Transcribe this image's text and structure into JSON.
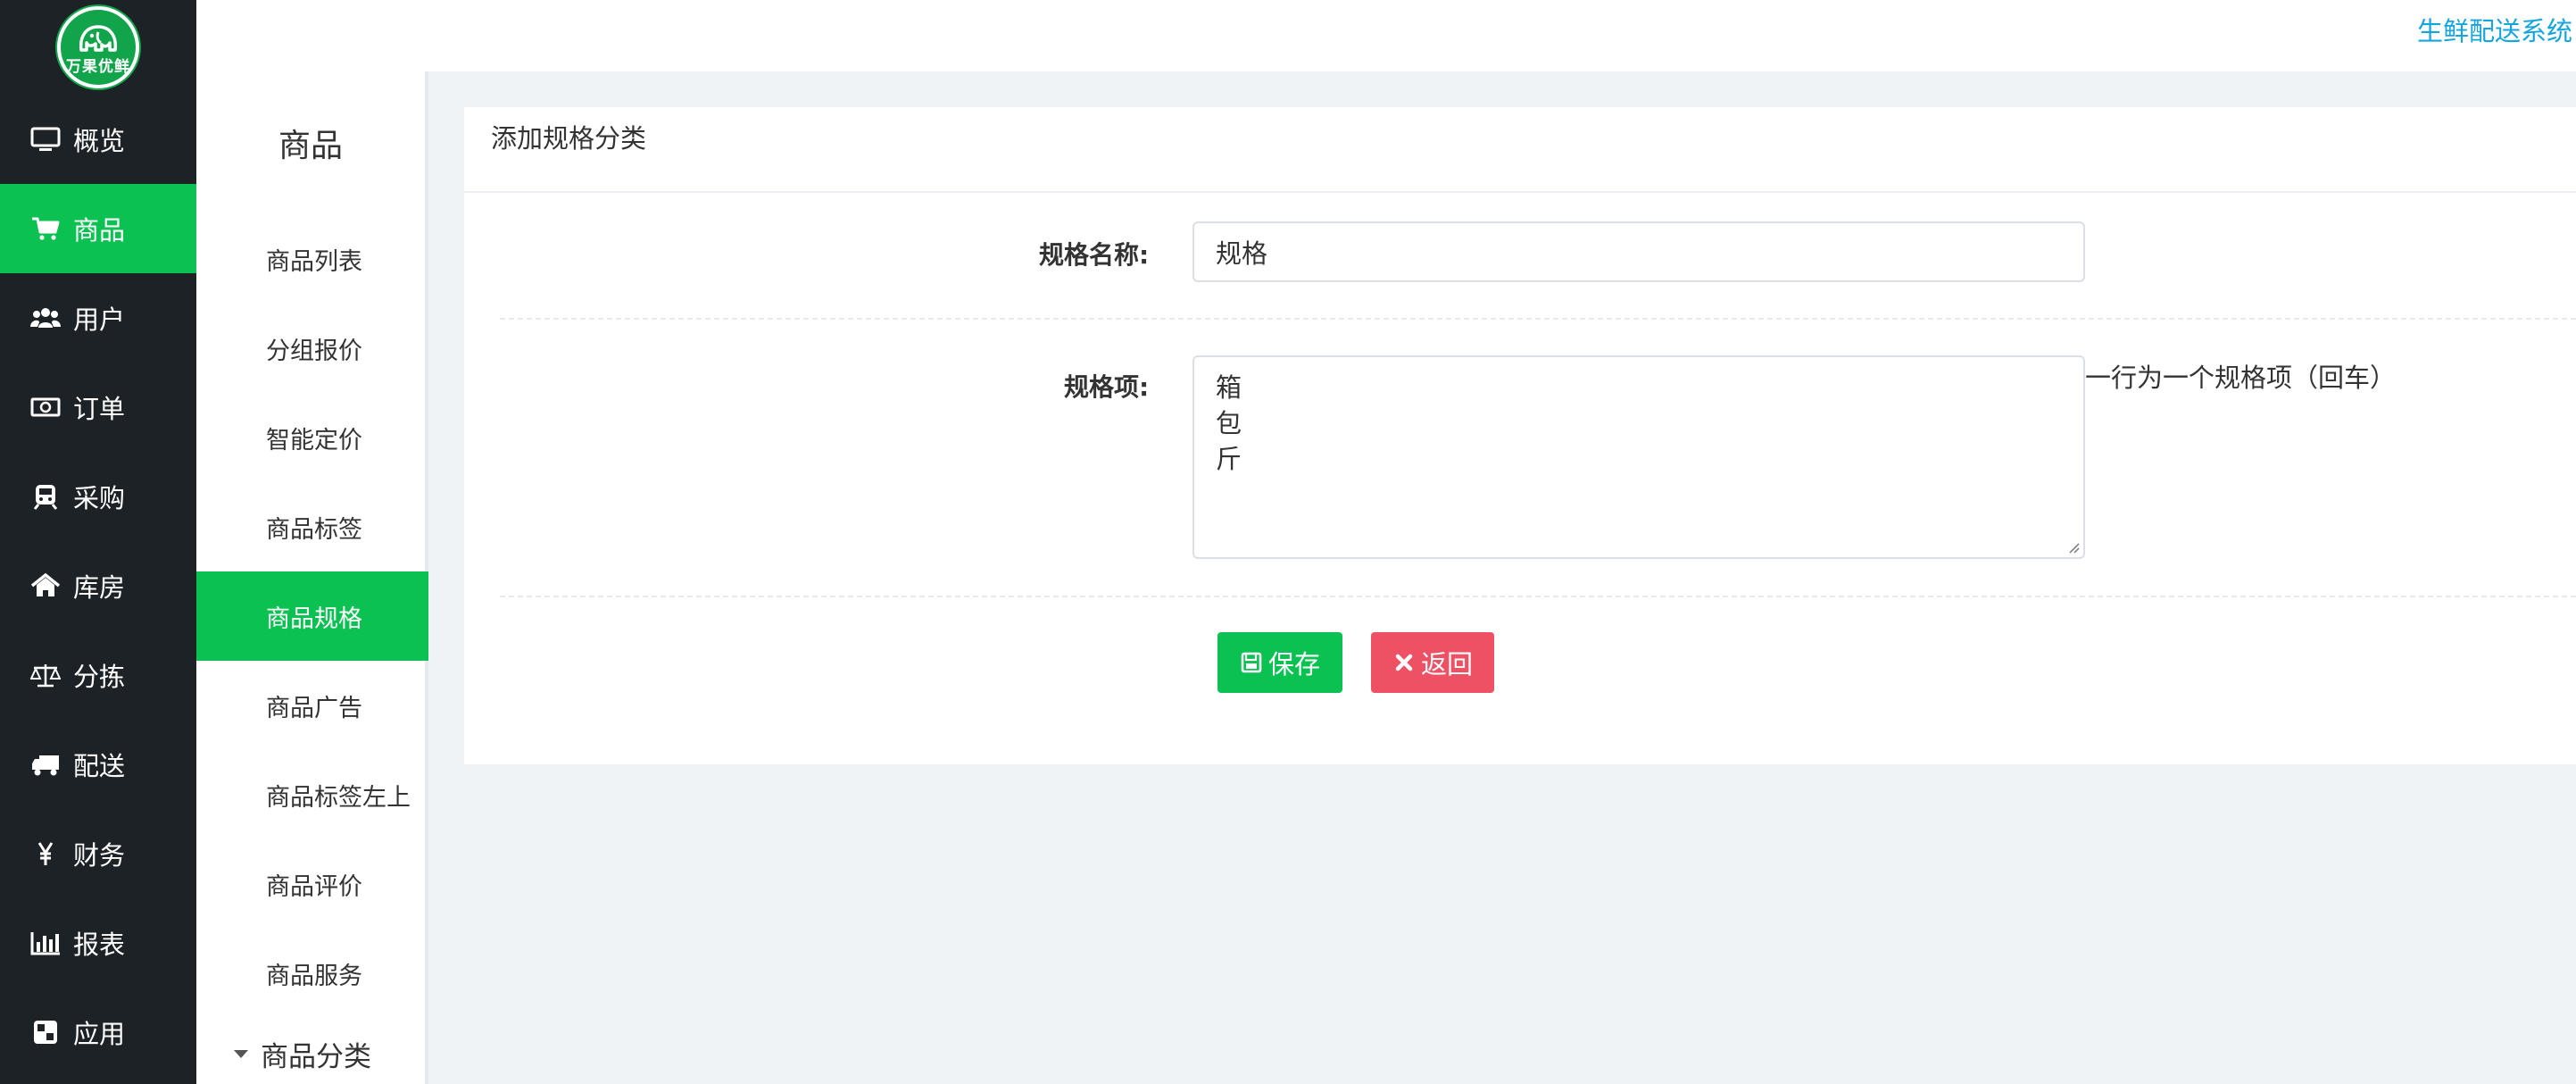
{
  "app": {
    "logo_text": "万果优鲜",
    "system_title": "生鲜配送系统"
  },
  "sidebar": {
    "items": [
      {
        "label": "概览",
        "icon": "monitor-icon",
        "active": false
      },
      {
        "label": "商品",
        "icon": "cart-icon",
        "active": true
      },
      {
        "label": "用户",
        "icon": "users-icon",
        "active": false
      },
      {
        "label": "订单",
        "icon": "money-icon",
        "active": false
      },
      {
        "label": "采购",
        "icon": "train-icon",
        "active": false
      },
      {
        "label": "库房",
        "icon": "home-icon",
        "active": false
      },
      {
        "label": "分拣",
        "icon": "balance-scale-icon",
        "active": false
      },
      {
        "label": "配送",
        "icon": "truck-icon",
        "active": false
      },
      {
        "label": "财务",
        "icon": "yen-icon",
        "active": false
      },
      {
        "label": "报表",
        "icon": "bar-chart-icon",
        "active": false
      },
      {
        "label": "应用",
        "icon": "apps-icon",
        "active": false
      }
    ]
  },
  "submenu": {
    "title": "商品",
    "items": [
      {
        "label": "商品列表",
        "active": false
      },
      {
        "label": "分组报价",
        "active": false
      },
      {
        "label": "智能定价",
        "active": false
      },
      {
        "label": "商品标签",
        "active": false
      },
      {
        "label": "商品规格",
        "active": true
      },
      {
        "label": "商品广告",
        "active": false
      },
      {
        "label": "商品标签左上",
        "active": false
      },
      {
        "label": "商品评价",
        "active": false
      },
      {
        "label": "商品服务",
        "active": false
      }
    ],
    "group_label": "商品分类"
  },
  "panel": {
    "title": "添加规格分类",
    "spec_name_label": "规格名称:",
    "spec_name_value": "规格",
    "spec_items_label": "规格项:",
    "spec_items_lines": [
      "箱",
      "包",
      "斤"
    ],
    "spec_items_hint": "一行为一个规格项（回车）",
    "save_label": "保存",
    "back_label": "返回"
  },
  "colors": {
    "sidebar_bg": "#1c2226",
    "accent_green": "#0bc152",
    "danger_red": "#ee5064",
    "title_blue": "#15a5dd",
    "page_bg": "#eff3f6"
  }
}
